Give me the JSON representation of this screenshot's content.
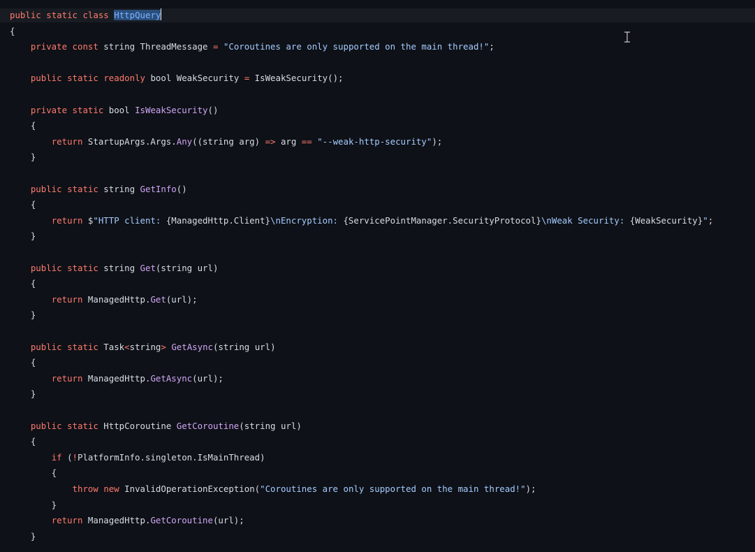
{
  "editor": {
    "theme_colors": {
      "background": "#0e1117",
      "current_line": "#181c22",
      "keyword": "#ff7a6e",
      "function": "#cfa6f5",
      "string": "#a5cbff",
      "text": "#d8dde4",
      "selection": "#2a4f7d"
    },
    "mouse_cursor_icon": "i-beam-cursor-icon",
    "lines": [
      [
        {
          "t": "public",
          "c": "kw"
        },
        {
          "t": " ",
          "c": "punc"
        },
        {
          "t": "static",
          "c": "kw"
        },
        {
          "t": " ",
          "c": "punc"
        },
        {
          "t": "class",
          "c": "kw"
        },
        {
          "t": " ",
          "c": "punc"
        },
        {
          "t": "HttpQuery",
          "c": "sel"
        }
      ],
      [
        {
          "t": "{",
          "c": "punc"
        }
      ],
      [
        {
          "t": "    ",
          "c": "punc"
        },
        {
          "t": "private",
          "c": "kw"
        },
        {
          "t": " ",
          "c": "punc"
        },
        {
          "t": "const",
          "c": "kw"
        },
        {
          "t": " string ThreadMessage ",
          "c": "type"
        },
        {
          "t": "=",
          "c": "op"
        },
        {
          "t": " ",
          "c": "punc"
        },
        {
          "t": "\"Coroutines are only supported on the main thread!\"",
          "c": "str"
        },
        {
          "t": ";",
          "c": "punc"
        }
      ],
      [],
      [
        {
          "t": "    ",
          "c": "punc"
        },
        {
          "t": "public",
          "c": "kw"
        },
        {
          "t": " ",
          "c": "punc"
        },
        {
          "t": "static",
          "c": "kw"
        },
        {
          "t": " ",
          "c": "punc"
        },
        {
          "t": "readonly",
          "c": "kw"
        },
        {
          "t": " bool WeakSecurity ",
          "c": "type"
        },
        {
          "t": "=",
          "c": "op"
        },
        {
          "t": " IsWeakSecurity();",
          "c": "ident"
        }
      ],
      [],
      [
        {
          "t": "    ",
          "c": "punc"
        },
        {
          "t": "private",
          "c": "kw"
        },
        {
          "t": " ",
          "c": "punc"
        },
        {
          "t": "static",
          "c": "kw"
        },
        {
          "t": " bool ",
          "c": "type"
        },
        {
          "t": "IsWeakSecurity",
          "c": "fn"
        },
        {
          "t": "()",
          "c": "punc"
        }
      ],
      [
        {
          "t": "    {",
          "c": "punc"
        }
      ],
      [
        {
          "t": "        ",
          "c": "punc"
        },
        {
          "t": "return",
          "c": "kw"
        },
        {
          "t": " StartupArgs.Args.",
          "c": "ident"
        },
        {
          "t": "Any",
          "c": "fn"
        },
        {
          "t": "((string arg) ",
          "c": "punc"
        },
        {
          "t": "=>",
          "c": "op"
        },
        {
          "t": " arg ",
          "c": "ident"
        },
        {
          "t": "==",
          "c": "op"
        },
        {
          "t": " ",
          "c": "punc"
        },
        {
          "t": "\"--weak-http-security\"",
          "c": "str"
        },
        {
          "t": ");",
          "c": "punc"
        }
      ],
      [
        {
          "t": "    }",
          "c": "punc"
        }
      ],
      [],
      [
        {
          "t": "    ",
          "c": "punc"
        },
        {
          "t": "public",
          "c": "kw"
        },
        {
          "t": " ",
          "c": "punc"
        },
        {
          "t": "static",
          "c": "kw"
        },
        {
          "t": " string ",
          "c": "type"
        },
        {
          "t": "GetInfo",
          "c": "fn"
        },
        {
          "t": "()",
          "c": "punc"
        }
      ],
      [
        {
          "t": "    {",
          "c": "punc"
        }
      ],
      [
        {
          "t": "        ",
          "c": "punc"
        },
        {
          "t": "return",
          "c": "kw"
        },
        {
          "t": " $",
          "c": "punc"
        },
        {
          "t": "\"HTTP client: ",
          "c": "str"
        },
        {
          "t": "{ManagedHttp.Client}",
          "c": "interp"
        },
        {
          "t": "\\n",
          "c": "esc"
        },
        {
          "t": "Encryption: ",
          "c": "str"
        },
        {
          "t": "{ServicePointManager.SecurityProtocol}",
          "c": "interp"
        },
        {
          "t": "\\n",
          "c": "esc"
        },
        {
          "t": "Weak Security: ",
          "c": "str"
        },
        {
          "t": "{WeakSecurity}",
          "c": "interp"
        },
        {
          "t": "\"",
          "c": "str"
        },
        {
          "t": ";",
          "c": "punc"
        }
      ],
      [
        {
          "t": "    }",
          "c": "punc"
        }
      ],
      [],
      [
        {
          "t": "    ",
          "c": "punc"
        },
        {
          "t": "public",
          "c": "kw"
        },
        {
          "t": " ",
          "c": "punc"
        },
        {
          "t": "static",
          "c": "kw"
        },
        {
          "t": " string ",
          "c": "type"
        },
        {
          "t": "Get",
          "c": "fn"
        },
        {
          "t": "(string url)",
          "c": "punc"
        }
      ],
      [
        {
          "t": "    {",
          "c": "punc"
        }
      ],
      [
        {
          "t": "        ",
          "c": "punc"
        },
        {
          "t": "return",
          "c": "kw"
        },
        {
          "t": " ManagedHttp.",
          "c": "ident"
        },
        {
          "t": "Get",
          "c": "fn"
        },
        {
          "t": "(url);",
          "c": "punc"
        }
      ],
      [
        {
          "t": "    }",
          "c": "punc"
        }
      ],
      [],
      [
        {
          "t": "    ",
          "c": "punc"
        },
        {
          "t": "public",
          "c": "kw"
        },
        {
          "t": " ",
          "c": "punc"
        },
        {
          "t": "static",
          "c": "kw"
        },
        {
          "t": " Task",
          "c": "type"
        },
        {
          "t": "<",
          "c": "op"
        },
        {
          "t": "string",
          "c": "gen"
        },
        {
          "t": ">",
          "c": "op"
        },
        {
          "t": " ",
          "c": "punc"
        },
        {
          "t": "GetAsync",
          "c": "fn"
        },
        {
          "t": "(string url)",
          "c": "punc"
        }
      ],
      [
        {
          "t": "    {",
          "c": "punc"
        }
      ],
      [
        {
          "t": "        ",
          "c": "punc"
        },
        {
          "t": "return",
          "c": "kw"
        },
        {
          "t": " ManagedHttp.",
          "c": "ident"
        },
        {
          "t": "GetAsync",
          "c": "fn"
        },
        {
          "t": "(url);",
          "c": "punc"
        }
      ],
      [
        {
          "t": "    }",
          "c": "punc"
        }
      ],
      [],
      [
        {
          "t": "    ",
          "c": "punc"
        },
        {
          "t": "public",
          "c": "kw"
        },
        {
          "t": " ",
          "c": "punc"
        },
        {
          "t": "static",
          "c": "kw"
        },
        {
          "t": " HttpCoroutine ",
          "c": "type"
        },
        {
          "t": "GetCoroutine",
          "c": "fn"
        },
        {
          "t": "(string url)",
          "c": "punc"
        }
      ],
      [
        {
          "t": "    {",
          "c": "punc"
        }
      ],
      [
        {
          "t": "        ",
          "c": "punc"
        },
        {
          "t": "if",
          "c": "kw"
        },
        {
          "t": " (",
          "c": "punc"
        },
        {
          "t": "!",
          "c": "op"
        },
        {
          "t": "PlatformInfo.singleton.IsMainThread)",
          "c": "ident"
        }
      ],
      [
        {
          "t": "        {",
          "c": "punc"
        }
      ],
      [
        {
          "t": "            ",
          "c": "punc"
        },
        {
          "t": "throw",
          "c": "kw"
        },
        {
          "t": " ",
          "c": "punc"
        },
        {
          "t": "new",
          "c": "kw"
        },
        {
          "t": " InvalidOperationException(",
          "c": "ident"
        },
        {
          "t": "\"Coroutines are only supported on the main thread!\"",
          "c": "str"
        },
        {
          "t": ");",
          "c": "punc"
        }
      ],
      [
        {
          "t": "        }",
          "c": "punc"
        }
      ],
      [
        {
          "t": "        ",
          "c": "punc"
        },
        {
          "t": "return",
          "c": "kw"
        },
        {
          "t": " ManagedHttp.",
          "c": "ident"
        },
        {
          "t": "GetCoroutine",
          "c": "fn"
        },
        {
          "t": "(url);",
          "c": "punc"
        }
      ],
      [
        {
          "t": "    }",
          "c": "punc"
        }
      ]
    ]
  }
}
